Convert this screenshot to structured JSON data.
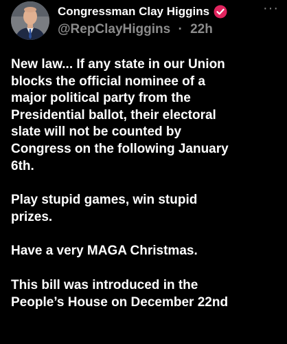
{
  "user": {
    "display_name": "Congressman Clay Higgins",
    "handle": "@RepClayHiggins",
    "separator": "·",
    "time": "22h"
  },
  "icons": {
    "verified": "verified-badge-icon",
    "more": "more-options-icon"
  },
  "colors": {
    "background": "#000000",
    "verified_badge": "#e0245e",
    "secondary_text": "#8b8b8b"
  },
  "more_label": "···",
  "paragraphs": [
    "New law... If any state in our Union\nblocks the official nominee of a\nmajor political party from the\nPresidential ballot, their electoral\nslate will not be counted by\nCongress on the following January\n6th.",
    "Play stupid games, win stupid\nprizes.",
    "Have a very MAGA Christmas.",
    "This bill was introduced in the\nPeople’s House on December 22nd"
  ]
}
